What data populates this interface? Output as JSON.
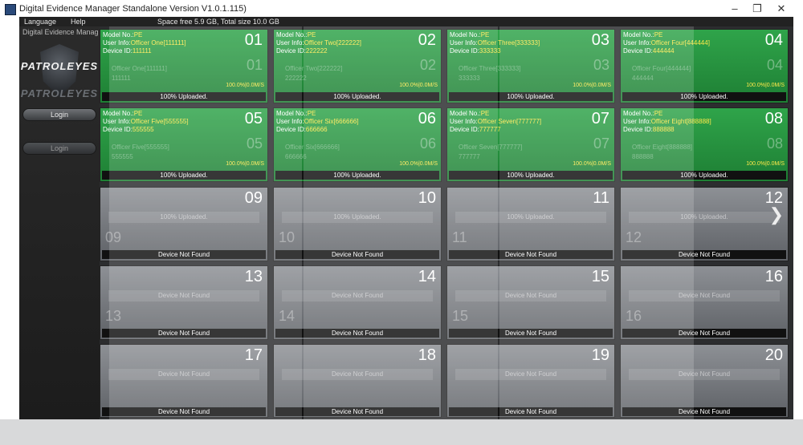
{
  "window": {
    "title": "Digital Evidence Manager Standalone Version V1.0.1.115)",
    "minimize": "–",
    "maximize": "❐",
    "close": "✕"
  },
  "menu": {
    "language": "Language",
    "help": "Help",
    "storage": "Space free 5.9 GB, Total size 10.0 GB"
  },
  "sidebar": {
    "ghost_title": "Digital Evidence Manag",
    "logo": "PATROLEYES",
    "login": "Login"
  },
  "labels": {
    "model": "Model No.:",
    "user": "User Info:",
    "device": "Device ID:",
    "uploaded": "100% Uploaded.",
    "not_found": "Device Not Found",
    "progress": "100.0%|0.0M/S"
  },
  "devices": [
    {
      "num": "01",
      "model": "PE",
      "user": "Officer One[111111]",
      "id": "111111"
    },
    {
      "num": "02",
      "model": "PE",
      "user": "Officer Two[222222]",
      "id": "222222"
    },
    {
      "num": "03",
      "model": "PE",
      "user": "Officer Three[333333]",
      "id": "333333"
    },
    {
      "num": "04",
      "model": "PE",
      "user": "Officer Four[444444]",
      "id": "444444"
    },
    {
      "num": "05",
      "model": "PE",
      "user": "Officer Five[555555]",
      "id": "555555"
    },
    {
      "num": "06",
      "model": "PE",
      "user": "Officer Six[666666]",
      "id": "666666"
    },
    {
      "num": "07",
      "model": "PE",
      "user": "Officer Seven[777777]",
      "id": "777777"
    },
    {
      "num": "08",
      "model": "PE",
      "user": "Officer Eight[888888]",
      "id": "888888"
    }
  ],
  "empty_slots": [
    "09",
    "10",
    "11",
    "12",
    "13",
    "14",
    "15",
    "16",
    "17",
    "18",
    "19",
    "20"
  ],
  "nav": {
    "next": "❯"
  },
  "colors": {
    "found": "#2fa44a",
    "not_found": "#8d9095",
    "highlight": "#ffe94a"
  }
}
